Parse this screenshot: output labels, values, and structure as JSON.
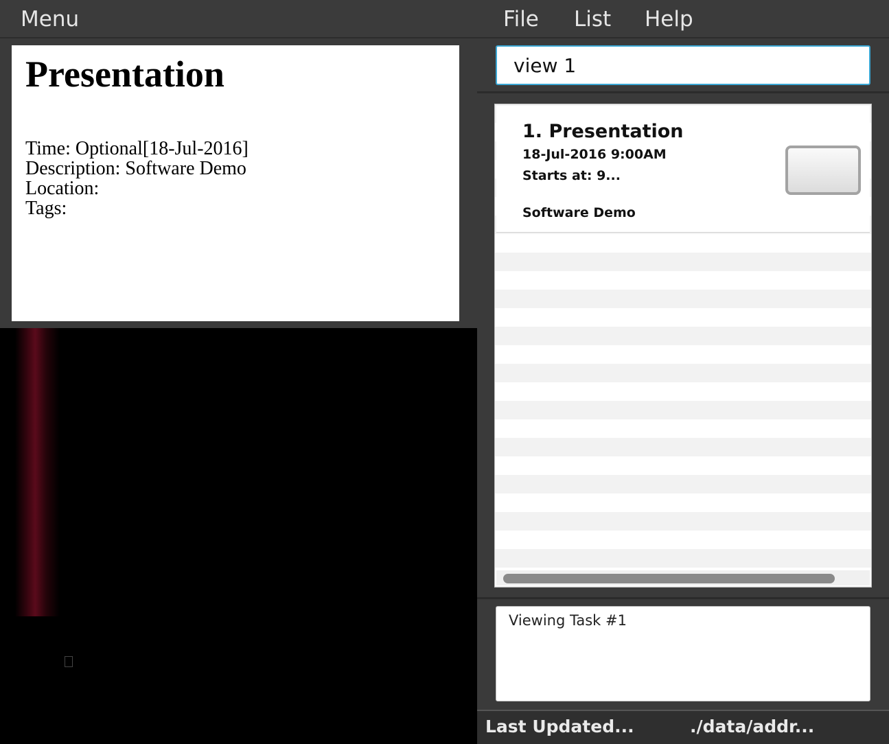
{
  "menubar": {
    "menu_label": "Menu",
    "file_label": "File",
    "list_label": "List",
    "help_label": "Help"
  },
  "detail": {
    "title": "Presentation",
    "time_line": "Time: Optional[18-Jul-2016]",
    "description_line": "Description: Software Demo",
    "location_line": "Location:",
    "tags_line": "Tags:"
  },
  "command": {
    "value": "view 1"
  },
  "task_list": {
    "items": [
      {
        "title": "1. Presentation",
        "date": "18-Jul-2016 9:00AM",
        "starts": "Starts at: 9...",
        "description": "Software Demo",
        "completed": false
      }
    ]
  },
  "result": {
    "message": "Viewing Task #1"
  },
  "status": {
    "last_updated": "Last Updated...",
    "path": "./data/addr..."
  },
  "colors": {
    "accent_focus": "#3aa7d4",
    "background": "#3a3a3a"
  }
}
